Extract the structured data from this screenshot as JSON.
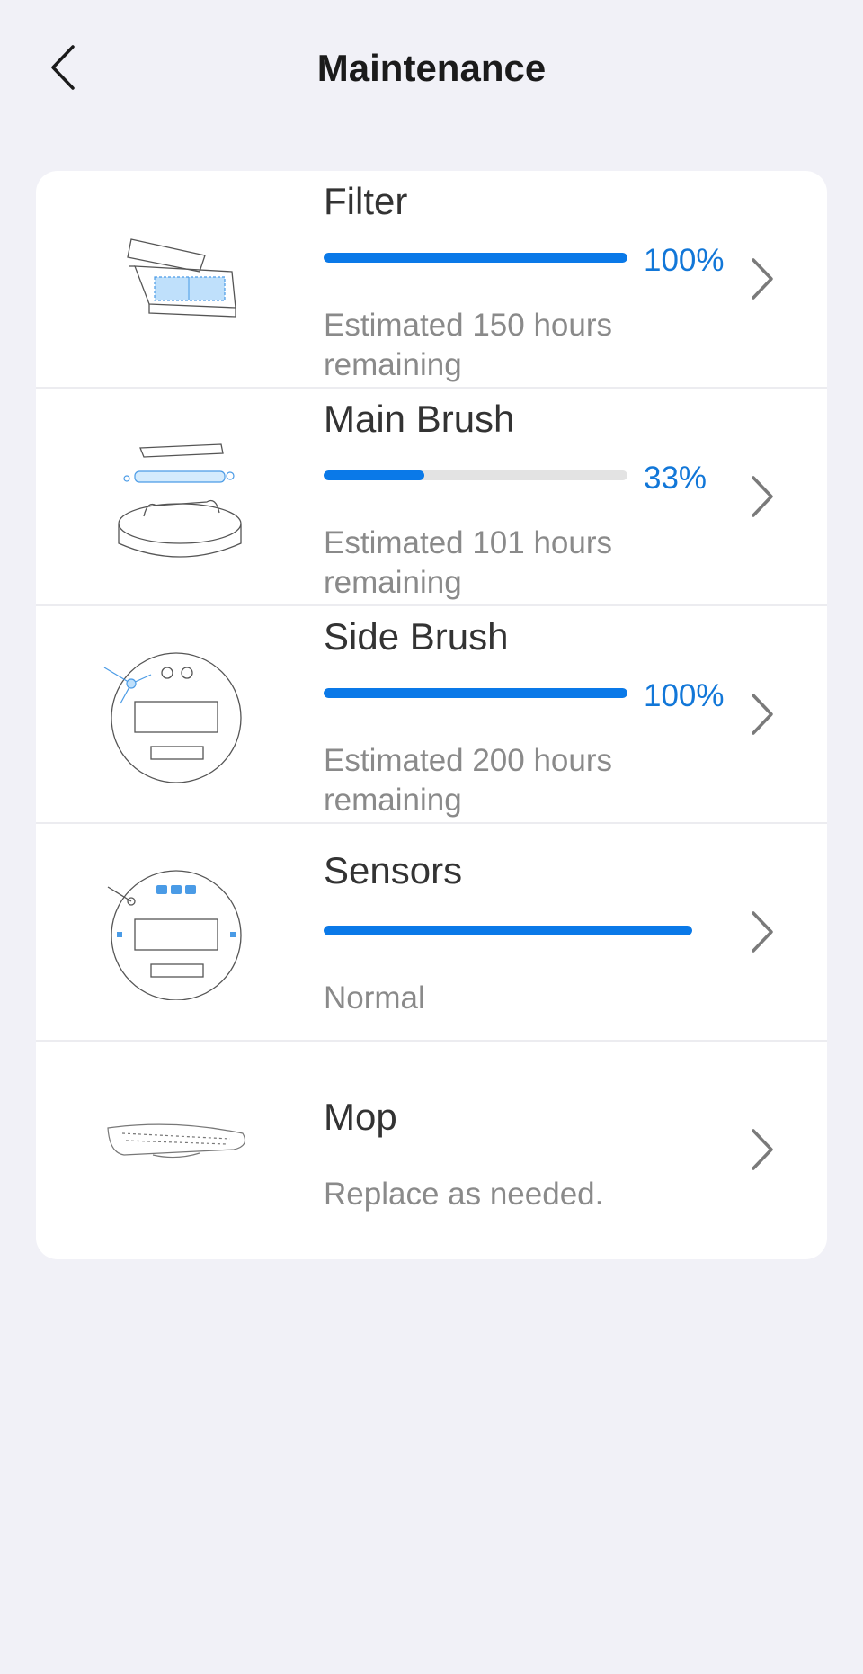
{
  "header": {
    "title": "Maintenance",
    "back_icon": "chevron-left-icon"
  },
  "colors": {
    "accent": "#0a79e8",
    "percent_text": "#1277d8",
    "track": "#e3e3e3",
    "background": "#f1f1f7"
  },
  "items": [
    {
      "id": "filter",
      "title": "Filter",
      "percent_label": "100%",
      "progress": 1.0,
      "description": "Estimated 150 hours remaining",
      "icon": "filter-icon"
    },
    {
      "id": "main-brush",
      "title": "Main Brush",
      "percent_label": "33%",
      "progress": 0.33,
      "description": "Estimated 101 hours remaining",
      "icon": "main-brush-icon"
    },
    {
      "id": "side-brush",
      "title": "Side Brush",
      "percent_label": "100%",
      "progress": 1.0,
      "description": "Estimated 200 hours remaining",
      "icon": "side-brush-icon"
    },
    {
      "id": "sensors",
      "title": "Sensors",
      "progress": 1.0,
      "description": "Normal",
      "icon": "sensors-icon"
    },
    {
      "id": "mop",
      "title": "Mop",
      "description": "Replace as needed.",
      "icon": "mop-icon"
    }
  ]
}
